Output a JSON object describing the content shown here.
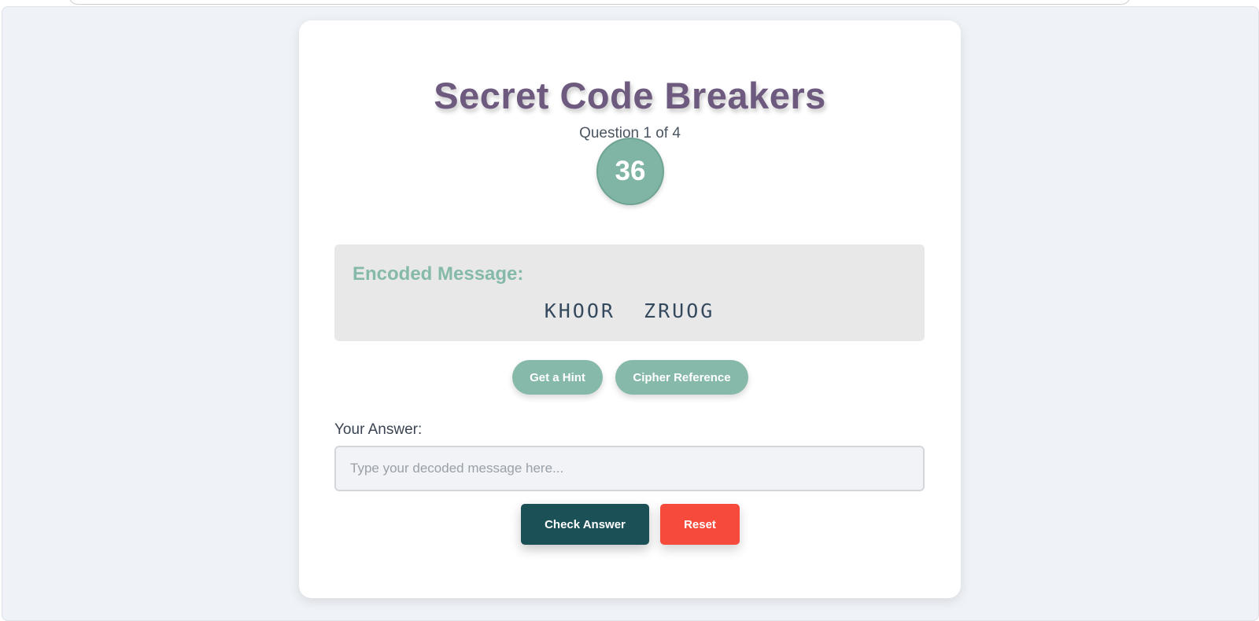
{
  "game": {
    "title": "Secret Code Breakers",
    "question_counter": "Question 1 of 4",
    "timer_value": "36",
    "encoded_label": "Encoded Message:",
    "encoded_message": "KHOOR  ZRUOG",
    "hint_button": "Get a Hint",
    "cipher_button": "Cipher Reference",
    "answer_label": "Your Answer:",
    "answer_placeholder": "Type your decoded message here...",
    "answer_value": "",
    "check_button": "Check Answer",
    "reset_button": "Reset"
  },
  "colors": {
    "title": "#6d5a7e",
    "accent_green": "#86b9a9",
    "check_button": "#1b5057",
    "reset_button": "#f64b3c",
    "page_background": "#eff2f7",
    "encoded_box": "#e8e8e8"
  }
}
